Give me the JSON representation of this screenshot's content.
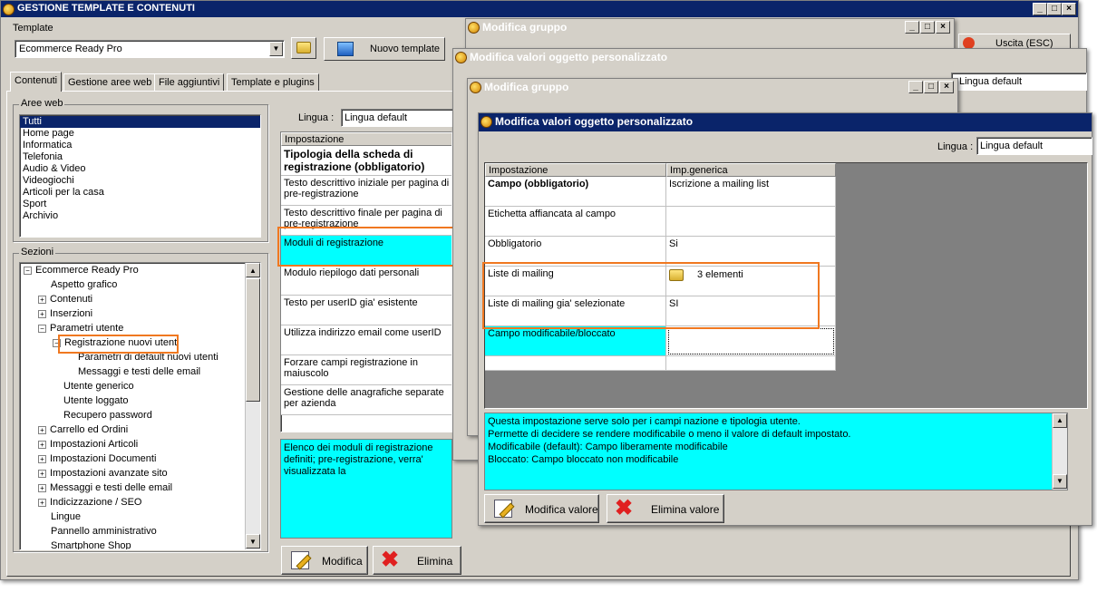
{
  "main": {
    "title": "GESTIONE TEMPLATE E CONTENUTI",
    "template_label": "Template",
    "template_value": "Ecommerce Ready Pro",
    "new_template": "Nuovo template",
    "exit": "Uscita (ESC)",
    "tabs": [
      "Contenuti",
      "Gestione aree web",
      "File aggiuntivi",
      "Template e plugins"
    ],
    "aree_label": "Aree web",
    "aree": [
      "Tutti",
      "Home page",
      "Informatica",
      "Telefonia",
      "Audio & Video",
      "Videogiochi",
      "Articoli per la casa",
      "Sport",
      "Archivio"
    ],
    "sezioni_label": "Sezioni",
    "tree": [
      "Ecommerce Ready Pro",
      "Aspetto grafico",
      "Contenuti",
      "Inserzioni",
      "Parametri utente",
      "Registrazione nuovi utenti",
      "Parametri di default nuovi utenti",
      "Messaggi e testi delle email",
      "Utente generico",
      "Utente loggato",
      "Recupero password",
      "Carrello ed Ordini",
      "Impostazioni Articoli",
      "Impostazioni Documenti",
      "Impostazioni avanzate sito",
      "Messaggi e testi delle email",
      "Indicizzazione / SEO",
      "Lingue",
      "Pannello amministrativo",
      "Smartphone Shop"
    ],
    "lingua_label": "Lingua :",
    "lingua_value": "Lingua default",
    "settings_header": "Impostazione",
    "settings": [
      "Tipologia della scheda di registrazione (obbligatorio)",
      "Testo descrittivo iniziale per pagina di pre-registrazione",
      "Testo descrittivo finale per pagina di pre-registrazione",
      "Moduli di registrazione",
      "Modulo riepilogo dati personali",
      "Testo per userID gia' esistente",
      "Utilizza indirizzo email come userID",
      "Forzare campi registrazione in maiuscolo",
      "Gestione delle anagrafiche separate per azienda"
    ],
    "desc": "Elenco dei moduli di registrazione definiti; pre-registrazione, verra' visualizzata la",
    "modify": "Modifica",
    "delete": "Elimina"
  },
  "w1": {
    "title": "Modifica gruppo"
  },
  "w2": {
    "title": "Modifica valori oggetto personalizzato",
    "lingua_value": "Lingua default"
  },
  "w3": {
    "title": "Modifica gruppo",
    "lingua_label": "Lingua :",
    "lingua_value": "Lingua default"
  },
  "w4": {
    "title": "Modifica valori oggetto personalizzato",
    "lingua_label": "Lingua :",
    "lingua_value": "Lingua default",
    "col1": "Impostazione",
    "col2": "Imp.generica",
    "rows": [
      {
        "k": "Campo (obbligatorio)",
        "v": "Iscrizione a mailing list"
      },
      {
        "k": "Etichetta affiancata al campo",
        "v": ""
      },
      {
        "k": "Obbligatorio",
        "v": "Si"
      },
      {
        "k": "Liste di mailing",
        "v": "3 elementi"
      },
      {
        "k": "Liste di mailing gia' selezionate",
        "v": "SI"
      },
      {
        "k": "Campo modificabile/bloccato",
        "v": ""
      }
    ],
    "info": [
      "Questa impostazione serve solo per i campi nazione e tipologia utente.",
      "Permette di decidere se rendere modificabile o meno il valore di default impostato.",
      "Modificabile (default): Campo liberamente modificabile",
      "Bloccato: Campo bloccato non modificabile"
    ],
    "modify_value": "Modifica valore",
    "delete_value": "Elimina valore"
  }
}
